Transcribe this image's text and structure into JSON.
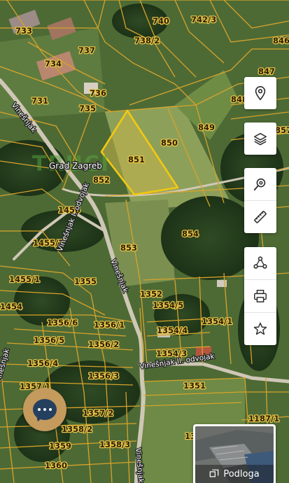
{
  "map": {
    "place_name": "Grad Zagreb",
    "watermark": "TRUCI",
    "selected_parcel": "851",
    "parcel_labels": [
      "733",
      "740",
      "742/3",
      "846",
      "737",
      "738/2",
      "734",
      "847",
      "736",
      "731",
      "848",
      "735",
      "849",
      "857",
      "850",
      "851",
      "852",
      "1456",
      "854",
      "1455/2",
      "853",
      "1455/1",
      "1355",
      "1352",
      "1354/5",
      "1454",
      "1356/6",
      "1356/1",
      "1354/4",
      "1354/1",
      "1356/5",
      "1356/2",
      "1354/3",
      "1356/4",
      "1356/3",
      "1351",
      "1357/1",
      "1357/2",
      "1187/1",
      "1358/2",
      "1359",
      "1358/3",
      "1360",
      "13"
    ],
    "road_labels": [
      "Vinešnjak",
      "Vinešnjak I. odvojak",
      "Vinešnjak",
      "Vinešnjak II. odvojak",
      "Vinešnjak",
      "Vinešnjak"
    ]
  },
  "toolbar": {
    "groups": [
      {
        "items": [
          "location-pin-icon"
        ]
      },
      {
        "items": [
          "layers-icon"
        ]
      },
      {
        "items": [
          "search-location-icon",
          "ruler-icon"
        ]
      },
      {
        "items": [
          "share-icon",
          "print-icon",
          "star-icon"
        ]
      }
    ]
  },
  "chat": {
    "icon": "chat-bubble-icon"
  },
  "basemap": {
    "label": "Podloga",
    "icon": "basemap-swap-icon"
  },
  "colors": {
    "parcel_line": "#d7a32a",
    "selected_outline": "#f2c811",
    "selected_fill": "#c9b44a",
    "toolbar_icon": "#2e2e2e",
    "chat_bg": "#c49a5d",
    "chat_bubble": "#25405f"
  }
}
